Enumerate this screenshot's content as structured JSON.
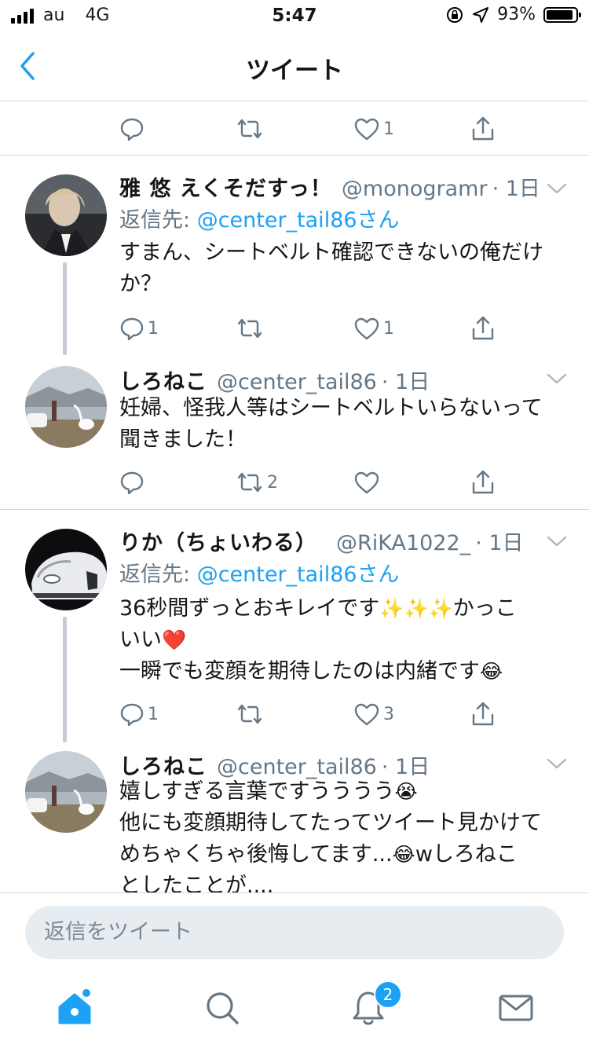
{
  "status_bar": {
    "carrier": "au",
    "network": "4G",
    "time": "5:47",
    "battery_percent": "93%",
    "battery_level": 0.93
  },
  "nav": {
    "title": "ツイート",
    "back_icon": "chevron-left-icon"
  },
  "colors": {
    "accent": "#1da1f2",
    "muted": "#657786",
    "divider": "#d8dde2",
    "thread_line": "#c5ccd3",
    "like_red": "#e0245e"
  },
  "top_actions": {
    "reply_count": "",
    "retweet_count": "",
    "like_count": "1"
  },
  "tweets": [
    {
      "name": "雅 悠 えくそだすっ！",
      "handle": "@monogramr",
      "time": "· 1日",
      "reply_prefix": "返信先: ",
      "reply_to": "@center_tail86さん",
      "lines": [
        "すまん、シートベルト確認できないの俺だけ",
        "か？"
      ],
      "reply_count": "1",
      "retweet_count": "",
      "like_count": "1"
    },
    {
      "name": "しろねこ",
      "handle": "@center_tail86",
      "time": "· 1日",
      "lines": [
        "妊婦、怪我人等はシートベルトいらないって",
        "聞きました！"
      ],
      "reply_count": "",
      "retweet_count": "2",
      "like_count": ""
    },
    {
      "name": "りか（ちょいわる）",
      "handle": "@RiKA1022_",
      "time": "· 1日",
      "reply_prefix": "返信先: ",
      "reply_to": "@center_tail86さん",
      "lines": [
        "36秒間ずっとおキレイです",
        "✨✨✨",
        "かっこ",
        "いい",
        "❤️",
        "一瞬でも変顔を期待したのは内緒です",
        "😂"
      ],
      "reply_count": "1",
      "retweet_count": "",
      "like_count": "3"
    },
    {
      "name": "しろねこ",
      "handle": "@center_tail86",
      "time": "· 1日",
      "lines": [
        "嬉しすぎる言葉ですうううう",
        "😭",
        "他にも変顔期待してたってツイート見かけて",
        "めちゃくちゃ後悔してます...",
        "😂",
        "wしろねこ",
        "としたことが...."
      ]
    }
  ],
  "reply_box": {
    "placeholder": "返信をツイート"
  },
  "tab_bar": {
    "notification_badge": "2"
  }
}
